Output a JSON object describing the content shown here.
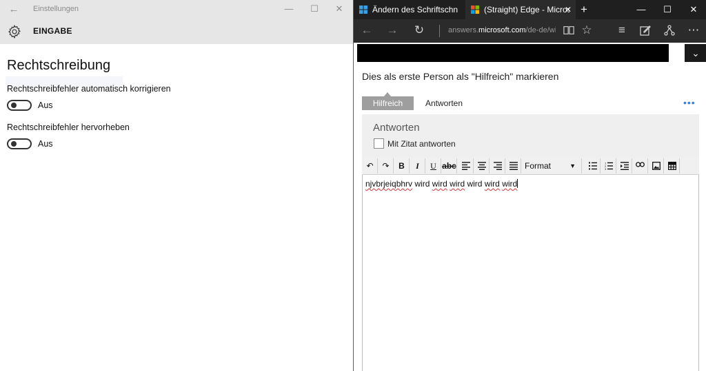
{
  "settings": {
    "window_title": "Einstellungen",
    "section": "EINGABE",
    "heading": "Rechtschreibung",
    "options": [
      {
        "label": "Rechtschreibfehler automatisch korrigieren",
        "state": "Aus"
      },
      {
        "label": "Rechtschreibfehler hervorheben",
        "state": "Aus"
      }
    ],
    "icons": {
      "back": "back-arrow-icon",
      "gear": "gear-icon"
    }
  },
  "edge": {
    "tabs": [
      {
        "title": "Ändern des Schriftschnitts u",
        "icon": "windows-logo-icon"
      },
      {
        "title": "(Straight) Edge - Micros",
        "icon": "windows-logo-icon"
      }
    ],
    "address": {
      "prefix": "answers.",
      "domain": "microsoft.com",
      "path": "/de-de/wi"
    },
    "mark_helpful": "Dies als erste Person als \"Hilfreich\" markieren",
    "helpful_button": "Hilfreich",
    "answer_link": "Antworten",
    "more": "•••",
    "reply_panel": {
      "title": "Antworten",
      "checkbox_label": "Mit Zitat antworten"
    },
    "toolbar": {
      "format_label": "Format"
    },
    "editor": {
      "words": [
        {
          "text": "njvbrjeiqbhrv",
          "misspelled": true
        },
        {
          "text": "wird",
          "misspelled": false
        },
        {
          "text": "wird",
          "misspelled": true
        },
        {
          "text": "wird",
          "misspelled": true
        },
        {
          "text": "wird",
          "misspelled": false
        },
        {
          "text": "wird",
          "misspelled": true
        },
        {
          "text": "wird",
          "misspelled": true
        }
      ]
    },
    "colors": {
      "accent": "#3b7dd8",
      "dark_chrome": "#2b2b2b",
      "squiggle": "#d13438"
    }
  }
}
